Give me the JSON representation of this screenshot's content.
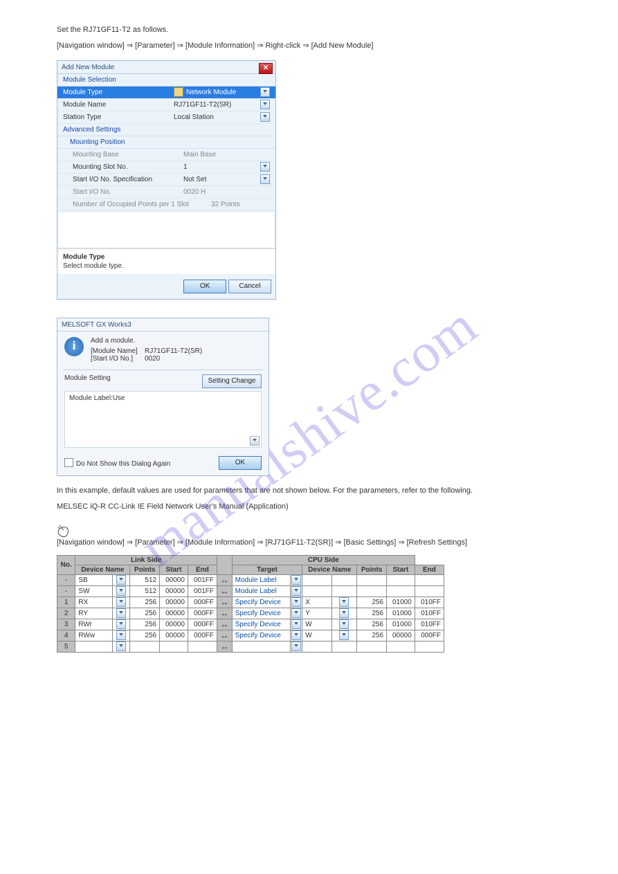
{
  "intro": {
    "p1": "Set the RJ71GF11-T2 as follows.",
    "p2": "[Navigation window] ⇒ [Parameter] ⇒ [Module Information] ⇒ Right-click ⇒ [Add New Module]"
  },
  "addModule": {
    "title": "Add New Module",
    "moduleSelection": "Module Selection",
    "moduleType_label": "Module Type",
    "moduleType_value": "Network Module",
    "moduleName_label": "Module Name",
    "moduleName_value": "RJ71GF11-T2(SR)",
    "stationType_label": "Station Type",
    "stationType_value": "Local Station",
    "advanced": "Advanced Settings",
    "mountingPosition": "Mounting Position",
    "mountingBase_label": "Mounting Base",
    "mountingBase_value": "Main Base",
    "mountingSlot_label": "Mounting Slot No.",
    "mountingSlot_value": "1",
    "startIoSpec_label": "Start I/O No. Specification",
    "startIoSpec_value": "Not Set",
    "startIo_label": "Start I/O No.",
    "startIo_value": "0020 H",
    "occPoints_label": "Number of Occupied Points per 1 Slot",
    "occPoints_value": "32 Points",
    "desc_h": "Module Type",
    "desc_t": "Select module type.",
    "ok": "OK",
    "cancel": "Cancel"
  },
  "confirm": {
    "title": "MELSOFT GX Works3",
    "head": "Add a module.",
    "l1k": "[Module Name]",
    "l1v": "RJ71GF11-T2(SR)",
    "l2k": "[Start I/O No.]",
    "l2v": "0020",
    "moduleSetting": "Module Setting",
    "settingChange": "Setting Change",
    "moduleLabelUse": "Module Label:Use",
    "dontShow": "Do Not Show this Dialog Again",
    "ok": "OK"
  },
  "after": {
    "p1": "In this example, default values are used for parameters that are not shown below. For the parameters, refer to the following.",
    "p2": "MELSEC iQ-R CC-Link IE Field Network User's Manual (Application)",
    "nav": "[Navigation window] ⇒ [Parameter] ⇒ [Module Information] ⇒ [RJ71GF11-T2(SR)] ⇒ [Basic Settings] ⇒ [Refresh Settings]"
  },
  "table": {
    "headers": {
      "no": "No.",
      "linkSide": "Link Side",
      "cpuSide": "CPU Side",
      "deviceName": "Device Name",
      "points": "Points",
      "start": "Start",
      "end": "End",
      "target": "Target"
    },
    "rows": [
      {
        "no": "-",
        "ldevice": "SB",
        "lpoints": "512",
        "lstart": "00000",
        "lend": "001FF",
        "target": "Module Label",
        "cdevice": "",
        "cpoints": "",
        "cstart": "",
        "cend": ""
      },
      {
        "no": "-",
        "ldevice": "SW",
        "lpoints": "512",
        "lstart": "00000",
        "lend": "001FF",
        "target": "Module Label",
        "cdevice": "",
        "cpoints": "",
        "cstart": "",
        "cend": ""
      },
      {
        "no": "1",
        "ldevice": "RX",
        "lpoints": "256",
        "lstart": "00000",
        "lend": "000FF",
        "target": "Specify Device",
        "cdevice": "X",
        "cpoints": "256",
        "cstart": "01000",
        "cend": "010FF"
      },
      {
        "no": "2",
        "ldevice": "RY",
        "lpoints": "256",
        "lstart": "00000",
        "lend": "000FF",
        "target": "Specify Device",
        "cdevice": "Y",
        "cpoints": "256",
        "cstart": "01000",
        "cend": "010FF"
      },
      {
        "no": "3",
        "ldevice": "RWr",
        "lpoints": "256",
        "lstart": "00000",
        "lend": "000FF",
        "target": "Specify Device",
        "cdevice": "W",
        "cpoints": "256",
        "cstart": "01000",
        "cend": "010FF"
      },
      {
        "no": "4",
        "ldevice": "RWw",
        "lpoints": "256",
        "lstart": "00000",
        "lend": "000FF",
        "target": "Specify Device",
        "cdevice": "W",
        "cpoints": "256",
        "cstart": "00000",
        "cend": "000FF"
      },
      {
        "no": "5",
        "ldevice": "",
        "lpoints": "",
        "lstart": "",
        "lend": "",
        "target": "",
        "cdevice": "",
        "cpoints": "",
        "cstart": "",
        "cend": ""
      }
    ]
  },
  "watermark": "manualshive.com"
}
